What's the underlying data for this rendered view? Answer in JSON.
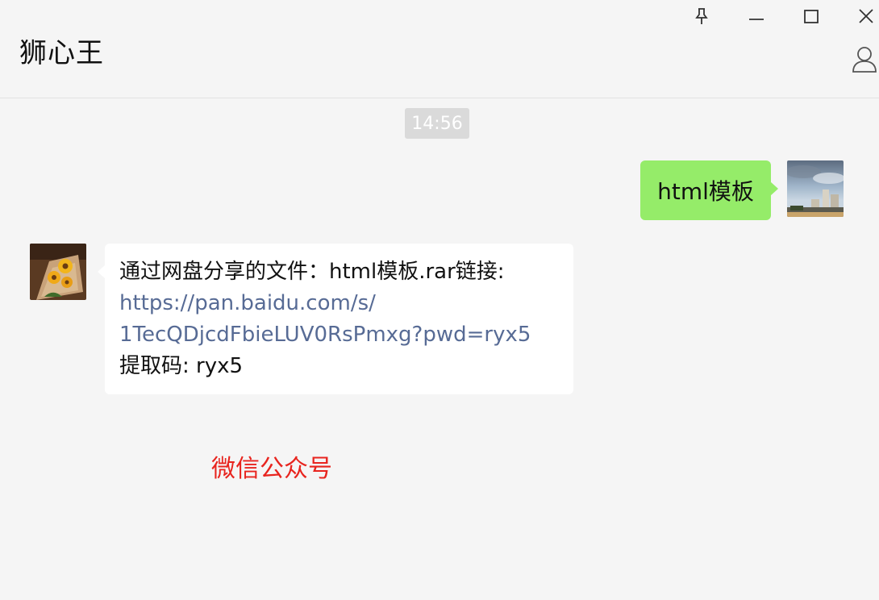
{
  "window": {
    "title": "狮心王",
    "buttons": {
      "pin": "pin-icon",
      "minimize": "minimize-icon",
      "maximize": "maximize-icon",
      "close": "close-icon",
      "profile": "person-icon"
    }
  },
  "chat": {
    "timestamp": "14:56",
    "messages": [
      {
        "sender": "self",
        "text": "html模板"
      },
      {
        "sender": "other",
        "line1": "通过网盘分享的文件：html模板.rar链接:",
        "link_line1": "https://pan.baidu.com/s/",
        "link_line2": "1TecQDjcdFbieLUV0RsPmxg?pwd=ryx5",
        "line_last": "提取码: ryx5"
      }
    ]
  },
  "overlay": {
    "watermark_text": "微信公众号"
  },
  "colors": {
    "background": "#f5f5f5",
    "sent_bubble": "#95ec69",
    "received_bubble": "#ffffff",
    "link": "#576b95",
    "watermark": "#e8241e",
    "timestamp_bg": "#dadada"
  }
}
